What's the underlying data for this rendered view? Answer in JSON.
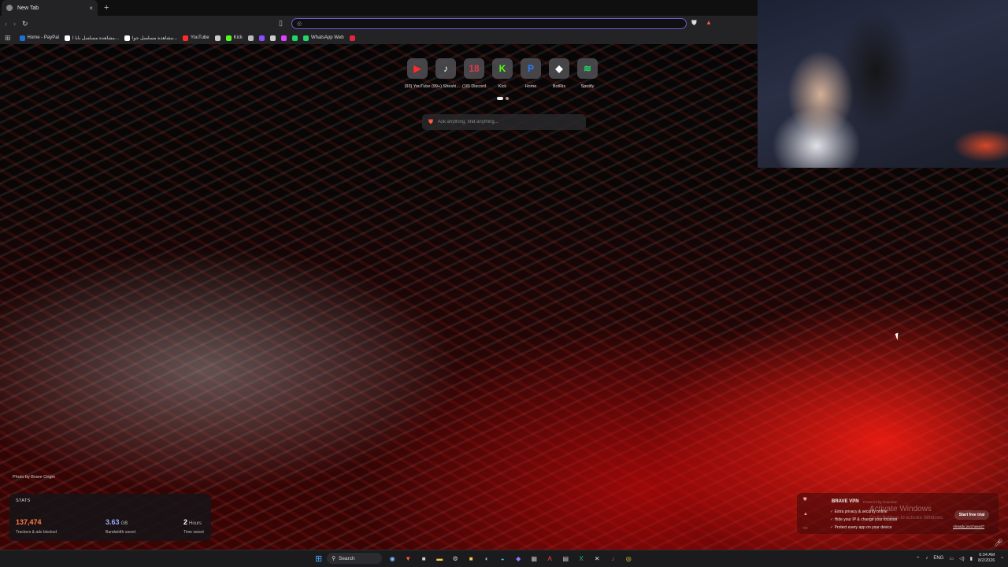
{
  "browser": {
    "tab": {
      "title": "New Tab",
      "close": "×"
    },
    "new_tab": "+",
    "nav": {
      "back": "‹",
      "forward": "›",
      "reload": "↻"
    },
    "address": {
      "value": "",
      "placeholder": ""
    },
    "bookmarks": [
      {
        "label": "Home - PayPal",
        "color": "#1f6fd6"
      },
      {
        "label": "مشاهدة مسلسل بابا ا...",
        "color": "#ffffff"
      },
      {
        "label": "مشاهدة مسلسل جوا...",
        "color": "#ffffff"
      },
      {
        "label": "YouTube",
        "color": "#ff2a2a"
      },
      {
        "label": "",
        "color": "#cccccc"
      },
      {
        "label": "Kick",
        "color": "#53fc18"
      },
      {
        "label": "",
        "color": "#bbbbbb"
      },
      {
        "label": "",
        "color": "#8a4dff"
      },
      {
        "label": "",
        "color": "#cccccc"
      },
      {
        "label": "",
        "color": "#e040ff"
      },
      {
        "label": "",
        "color": "#1ed760"
      },
      {
        "label": "WhatsApp Web",
        "color": "#25d366"
      },
      {
        "label": "",
        "color": "#e0283c"
      }
    ]
  },
  "top_sites": [
    {
      "label": "(93) YouTube",
      "glyph": "▶",
      "color": "#ff2a2a"
    },
    {
      "label": "(99+) Sheshi...",
      "glyph": "♪",
      "color": "#ffffff"
    },
    {
      "label": "(18) Discord",
      "glyph": "18",
      "color": "#e03c4c"
    },
    {
      "label": "Kick",
      "glyph": "K",
      "color": "#53fc18"
    },
    {
      "label": "Home",
      "glyph": "P",
      "color": "#2a7fff"
    },
    {
      "label": "BotRix",
      "glyph": "◆",
      "color": "#ffffff"
    },
    {
      "label": "Spotify",
      "glyph": "≋",
      "color": "#1ed760"
    }
  ],
  "search": {
    "placeholder": "Ask anything, find anything..."
  },
  "photo_credit": "Photo by Brave Origin",
  "stats": {
    "title": "STATS",
    "trackers": {
      "value": "137,474",
      "label": "Trackers & ads blocked",
      "color": "#ff7a45"
    },
    "bandwidth": {
      "value": "3.63",
      "unit": "GB",
      "label": "Bandwidth saved",
      "color": "#9aa8ff"
    },
    "time": {
      "value": "2",
      "unit": "Hours",
      "label": "Time saved",
      "color": "#ffffff"
    }
  },
  "vpn": {
    "title": "BRAVE VPN",
    "powered": "Powered by Guardian",
    "features": [
      "Extra privacy & security online",
      "Hide your IP & change your location",
      "Protect every app on your device"
    ],
    "cta": "Start free trial",
    "purchased": "Already purchased?"
  },
  "activate": {
    "line1": "Activate Windows",
    "line2": "Go to Settings to activate Windows."
  },
  "taskbar": {
    "search_label": "Search",
    "icons": [
      {
        "name": "copilot-icon",
        "glyph": "◉",
        "color": "#7fb6ff"
      },
      {
        "name": "brave-icon",
        "glyph": "▼",
        "color": "#ff5a3c"
      },
      {
        "name": "store-icon",
        "glyph": "■",
        "color": "#cccccc"
      },
      {
        "name": "explorer-icon",
        "glyph": "▬",
        "color": "#f2c94c"
      },
      {
        "name": "settings-icon",
        "glyph": "⚙",
        "color": "#cccccc"
      },
      {
        "name": "app-icon",
        "glyph": "■",
        "color": "#f2c94c"
      },
      {
        "name": "steam-icon",
        "glyph": "◐",
        "color": "#9ec6ff"
      },
      {
        "name": "edge-icon",
        "glyph": "◒",
        "color": "#33c1ff"
      },
      {
        "name": "teams-icon",
        "glyph": "◆",
        "color": "#8a7dff"
      },
      {
        "name": "calculator-icon",
        "glyph": "▦",
        "color": "#bbbbbb"
      },
      {
        "name": "acrobat-icon",
        "glyph": "A",
        "color": "#ff3b3b"
      },
      {
        "name": "notepad-icon",
        "glyph": "▤",
        "color": "#cccccc"
      },
      {
        "name": "excel-icon",
        "glyph": "X",
        "color": "#2fb36b"
      },
      {
        "name": "capcut-icon",
        "glyph": "✕",
        "color": "#dddddd"
      },
      {
        "name": "tiktok-icon",
        "glyph": "♪",
        "color": "#ff2d7a"
      },
      {
        "name": "chrome-icon",
        "glyph": "◎",
        "color": "#f2c94c"
      }
    ],
    "lang": "ENG",
    "time": "6:34 AM",
    "date": "8/2/2026"
  }
}
